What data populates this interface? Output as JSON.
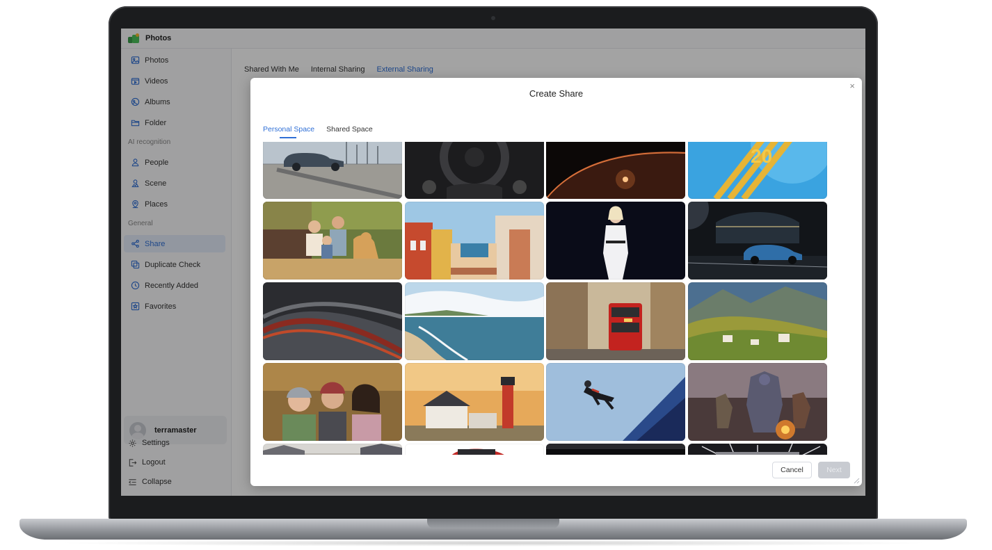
{
  "app": {
    "title": "Photos"
  },
  "sidebar": {
    "items": [
      {
        "label": "Photos",
        "icon": "image-icon"
      },
      {
        "label": "Videos",
        "icon": "video-icon"
      },
      {
        "label": "Albums",
        "icon": "album-icon"
      },
      {
        "label": "Folder",
        "icon": "folder-icon"
      }
    ],
    "section_ai": "AI recognition",
    "ai_items": [
      {
        "label": "People",
        "icon": "person-icon"
      },
      {
        "label": "Scene",
        "icon": "scene-icon"
      },
      {
        "label": "Places",
        "icon": "location-icon"
      }
    ],
    "section_general": "General",
    "general_items": [
      {
        "label": "Share",
        "icon": "share-icon",
        "active": true
      },
      {
        "label": "Duplicate Check",
        "icon": "duplicate-icon"
      },
      {
        "label": "Recently Added",
        "icon": "clock-icon"
      },
      {
        "label": "Favorites",
        "icon": "favorite-icon"
      }
    ],
    "user": {
      "name": "terramaster"
    },
    "bottom": [
      {
        "label": "Settings",
        "icon": "gear-icon"
      },
      {
        "label": "Logout",
        "icon": "logout-icon"
      },
      {
        "label": "Collapse",
        "icon": "collapse-icon"
      }
    ]
  },
  "main": {
    "tabs": [
      {
        "label": "Shared With Me",
        "active": false
      },
      {
        "label": "Internal Sharing",
        "active": false
      },
      {
        "label": "External Sharing",
        "active": true
      }
    ]
  },
  "modal": {
    "title": "Create Share",
    "close_symbol": "×",
    "tabs": [
      {
        "label": "Personal Space",
        "active": true
      },
      {
        "label": "Shared Space",
        "active": false
      }
    ],
    "cancel_label": "Cancel",
    "next_label": "Next"
  },
  "colors": {
    "accent": "#2f6fd6",
    "overlay": "rgba(0,0,0,0.36)"
  },
  "photos": [
    {
      "subject": "car-on-pier"
    },
    {
      "subject": "steering-wheel"
    },
    {
      "subject": "planet-sunrise"
    },
    {
      "subject": "golden-2020"
    },
    {
      "subject": "family-with-dog"
    },
    {
      "subject": "colorful-town"
    },
    {
      "subject": "woman-in-white"
    },
    {
      "subject": "suv-at-night"
    },
    {
      "subject": "abstract-waves"
    },
    {
      "subject": "beach-coast"
    },
    {
      "subject": "red-bus-street"
    },
    {
      "subject": "alpine-village"
    },
    {
      "subject": "three-friends"
    },
    {
      "subject": "lighthouse"
    },
    {
      "subject": "skydiver"
    },
    {
      "subject": "game-battle"
    },
    {
      "subject": "rooftops"
    },
    {
      "subject": "red-car"
    },
    {
      "subject": "dark-scene"
    },
    {
      "subject": "stadium-lights"
    }
  ]
}
